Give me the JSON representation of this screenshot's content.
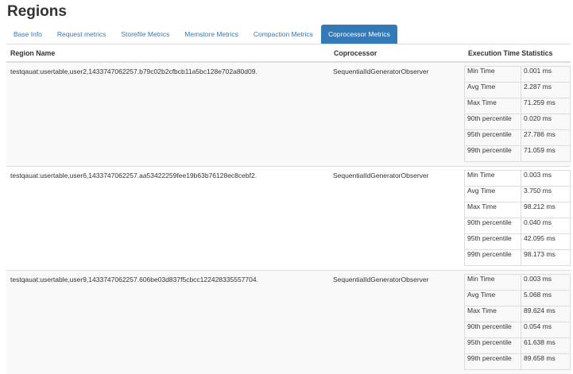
{
  "page": {
    "title": "Regions"
  },
  "tabs": [
    {
      "label": "Base Info",
      "active": false
    },
    {
      "label": "Request metrics",
      "active": false
    },
    {
      "label": "Storefile Metrics",
      "active": false
    },
    {
      "label": "Memstore Metrics",
      "active": false
    },
    {
      "label": "Compaction Metrics",
      "active": false
    },
    {
      "label": "Coprocessor Metrics",
      "active": true
    }
  ],
  "colors": {
    "accent": "#337ab7",
    "stripe": "#f9f9f9",
    "border": "#dddddd"
  },
  "table": {
    "headers": [
      "Region Name",
      "Coprocessor",
      "Execution Time Statistics"
    ],
    "rows": [
      {
        "region": "testqauat:usertable,user2,1433747062257.b79c02b2cfbcb11a5bc128e702a80d09.",
        "coprocessor": "SequentialIdGeneratorObserver",
        "stats": [
          {
            "label": "Min Time",
            "value": "0.001 ms"
          },
          {
            "label": "Avg Time",
            "value": "2.287 ms"
          },
          {
            "label": "Max Time",
            "value": "71.259 ms"
          },
          {
            "label": "90th percentile",
            "value": "0.020 ms"
          },
          {
            "label": "95th percentile",
            "value": "27.786 ms"
          },
          {
            "label": "99th percentile",
            "value": "71.059 ms"
          }
        ]
      },
      {
        "region": "testqauat:usertable,user6,1433747062257.aa53422259fee19b63b76128ec8cebf2.",
        "coprocessor": "SequentialIdGeneratorObserver",
        "stats": [
          {
            "label": "Min Time",
            "value": "0.003 ms"
          },
          {
            "label": "Avg Time",
            "value": "3.750 ms"
          },
          {
            "label": "Max Time",
            "value": "98.212 ms"
          },
          {
            "label": "90th percentile",
            "value": "0.040 ms"
          },
          {
            "label": "95th percentile",
            "value": "42.095 ms"
          },
          {
            "label": "99th percentile",
            "value": "98.173 ms"
          }
        ]
      },
      {
        "region": "testqauat:usertable,user9,1433747062257.606be03d837f5cbcc122428335557704.",
        "coprocessor": "SequentialIdGeneratorObserver",
        "stats": [
          {
            "label": "Min Time",
            "value": "0.003 ms"
          },
          {
            "label": "Avg Time",
            "value": "5.068 ms"
          },
          {
            "label": "Max Time",
            "value": "89.624 ms"
          },
          {
            "label": "90th percentile",
            "value": "0.054 ms"
          },
          {
            "label": "95th percentile",
            "value": "61.638 ms"
          },
          {
            "label": "99th percentile",
            "value": "89.658 ms"
          }
        ]
      }
    ]
  }
}
